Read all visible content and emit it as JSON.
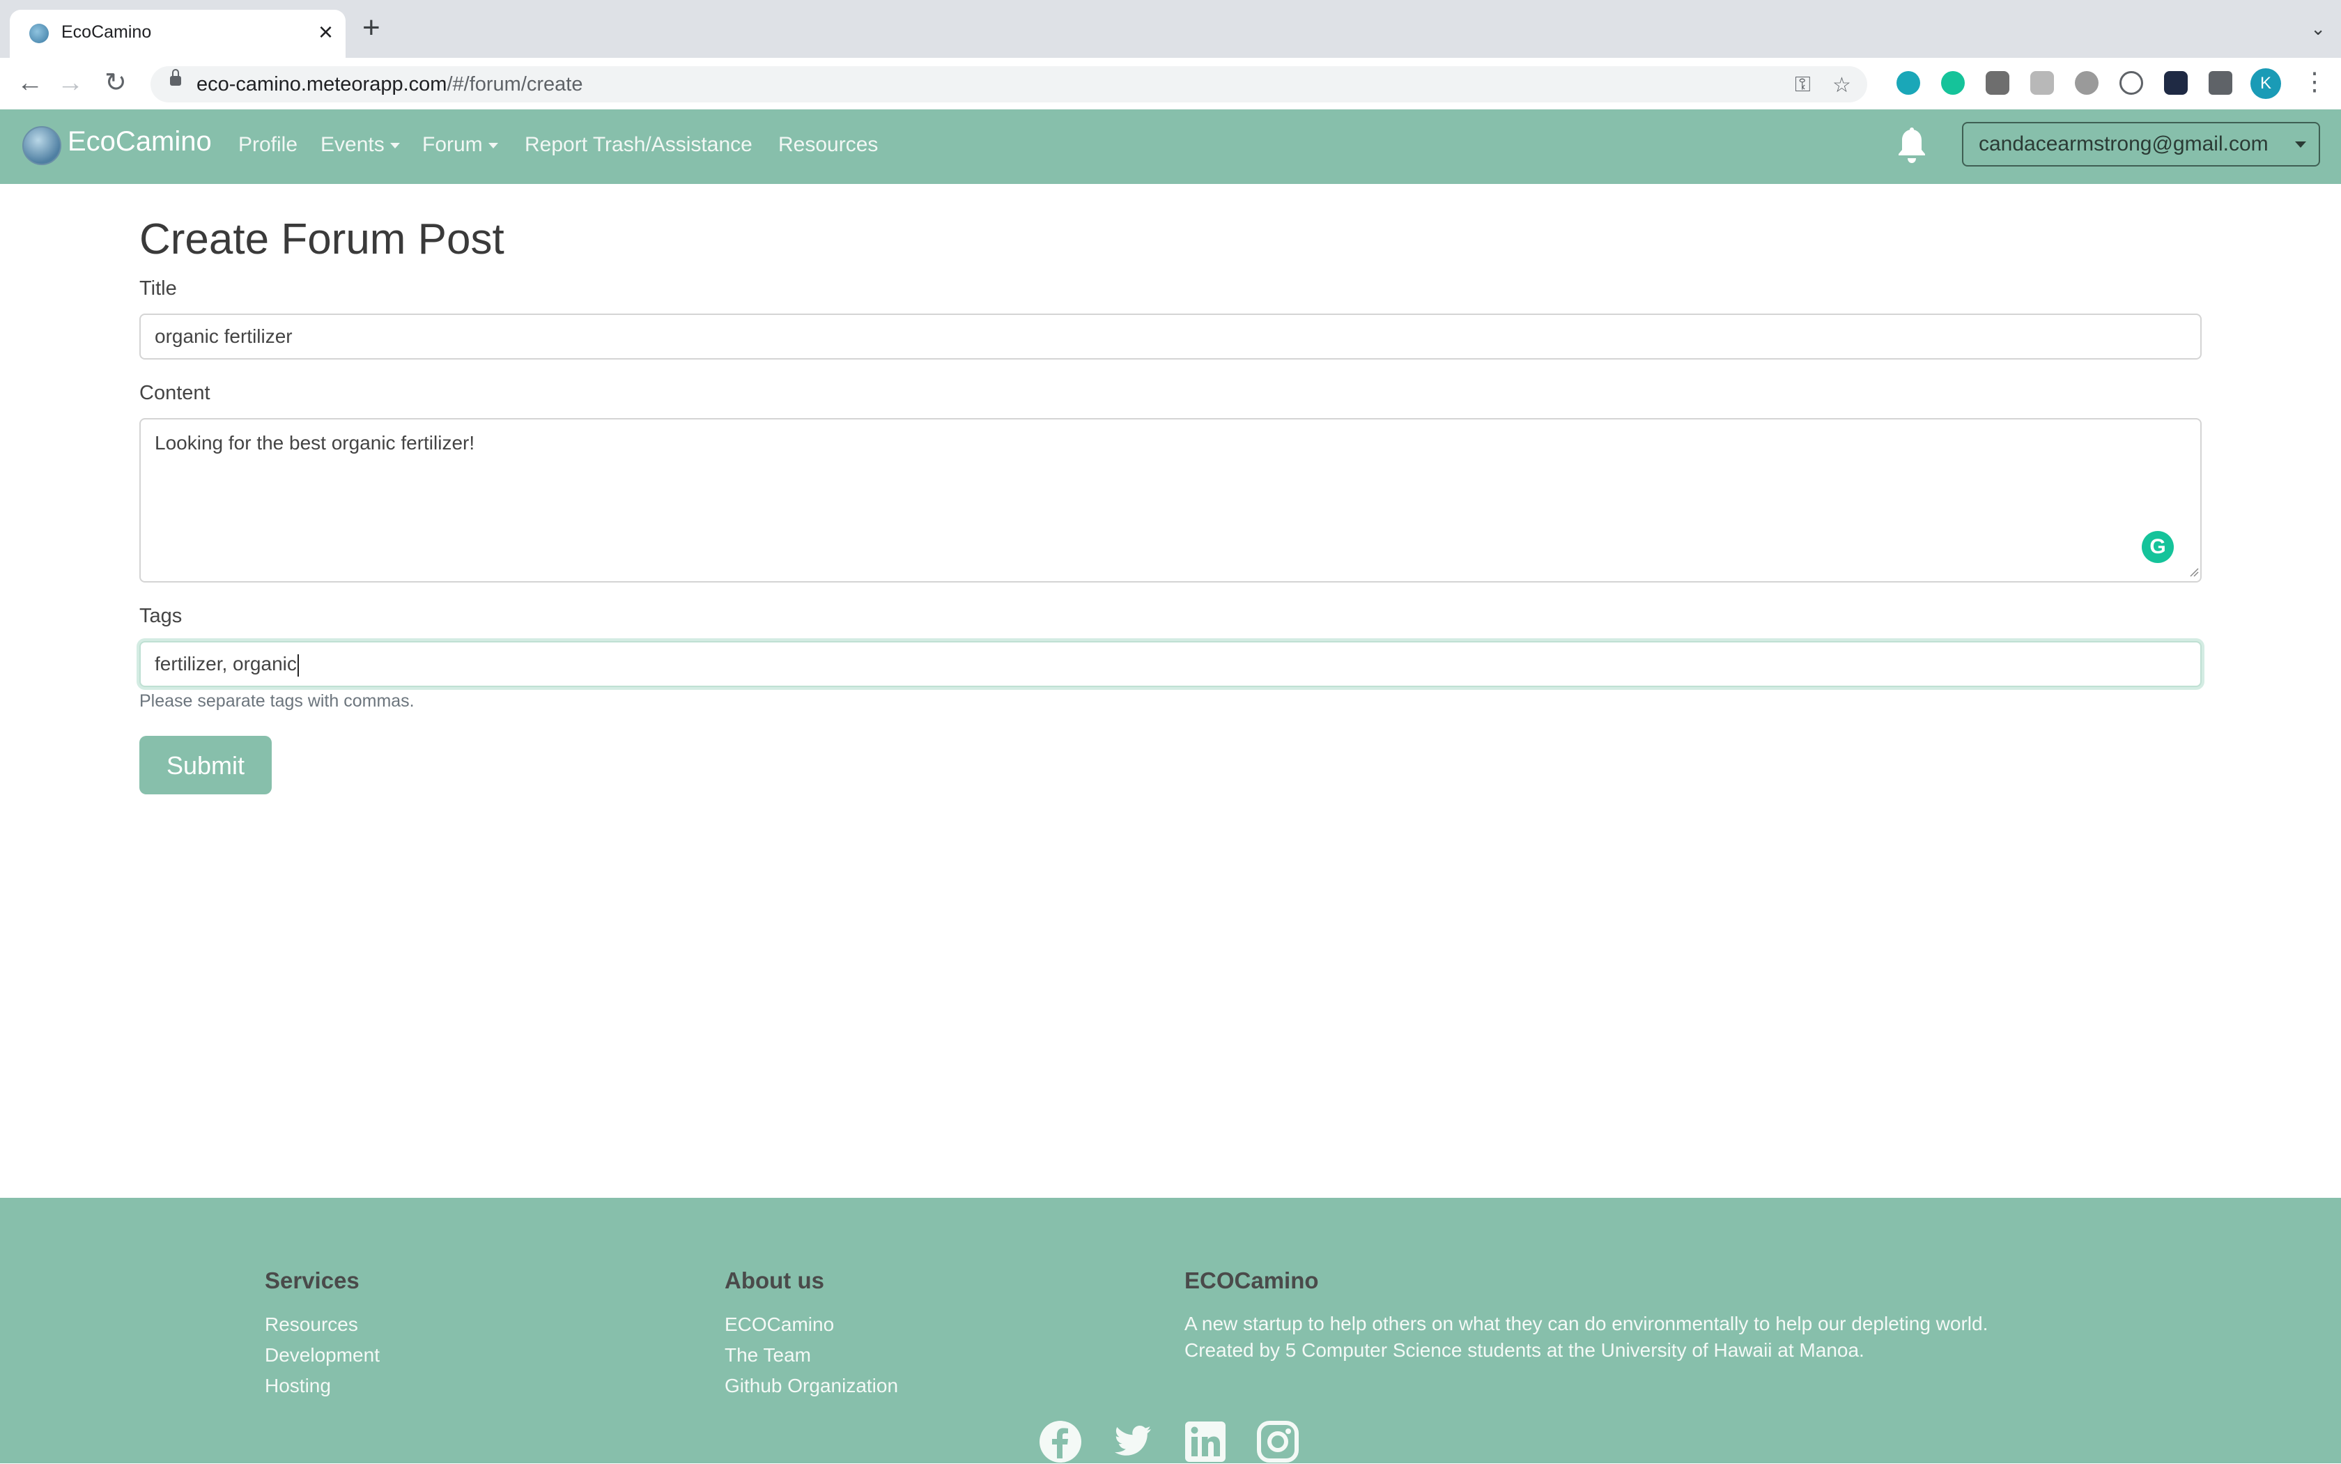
{
  "browser": {
    "tab_title": "EcoCamino",
    "url_host": "eco-camino.meteorapp.com",
    "url_path": "/#/forum/create",
    "profile_initial": "K"
  },
  "navbar": {
    "brand": "EcoCamino",
    "links": [
      "Profile",
      "Events",
      "Forum",
      "Report Trash/Assistance",
      "Resources"
    ],
    "user_email": "candacearmstrong@gmail.com"
  },
  "form": {
    "heading": "Create Forum Post",
    "title_label": "Title",
    "title_value": "organic fertilizer",
    "content_label": "Content",
    "content_value": "Looking for the best organic fertilizer!",
    "tags_label": "Tags",
    "tags_value": "fertilizer, organic",
    "tags_help": "Please separate tags with commas.",
    "submit_label": "Submit"
  },
  "footer": {
    "services": {
      "heading": "Services",
      "links": [
        "Resources",
        "Development",
        "Hosting"
      ]
    },
    "about": {
      "heading": "About us",
      "links": [
        "ECOCamino",
        "The Team",
        "Github Organization"
      ]
    },
    "company": {
      "heading": "ECOCamino",
      "line1": "A new startup to help others on what they can do environmentally to help our depleting world.",
      "line2": "Created by 5 Computer Science students at the University of Hawaii at Manoa."
    }
  },
  "colors": {
    "brand_green": "#87bfab",
    "grammarly_green": "#15c39a"
  }
}
